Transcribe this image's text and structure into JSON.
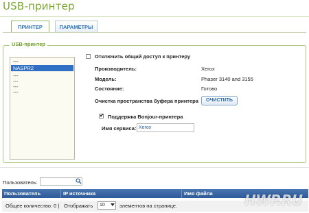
{
  "page": {
    "title": "USB-принтер"
  },
  "tabs": [
    {
      "label": "ПРИНТЕР",
      "active": true
    },
    {
      "label": "ПАРАМЕТРЫ",
      "active": false
    }
  ],
  "printer_section": {
    "legend": "USB-принтер",
    "list_items": [
      "---",
      "NASPR2",
      "---",
      "---",
      "---",
      "---"
    ],
    "selected_item": "NASPR2",
    "disable_sharing": {
      "label": "Отключить общий доступ к принтеру",
      "checked": false
    },
    "manufacturer": {
      "label": "Производитель:",
      "value": "Xerox"
    },
    "model": {
      "label": "Модель:",
      "value": "Phaser 3140 and 3155"
    },
    "state": {
      "label": "Состояние:",
      "value": "Готово"
    },
    "clear_buffer": {
      "label": "Очистка пространства буфера принтера",
      "button": "ОЧИСТИТЬ"
    },
    "bonjour": {
      "label": "Поддержка Bonjour-принтера",
      "checked": true
    },
    "service_name": {
      "label": "Имя сервиса:",
      "value": "Xerox"
    }
  },
  "filter": {
    "user_label": "Пользователь:",
    "search_icon": "search-icon"
  },
  "table": {
    "columns": [
      "Пользователь",
      "IP источника",
      "Имя файла"
    ]
  },
  "footer": {
    "total_label": "Общее количество: 0 |",
    "show_label": "Отображать",
    "per_page": "10",
    "per_page_suffix": "элементов на странице."
  },
  "watermark": "HWP.RU",
  "colors": {
    "title_green": "#7aa632",
    "header_blue": "#2c5a98",
    "selection_blue": "#2f6fc4"
  }
}
